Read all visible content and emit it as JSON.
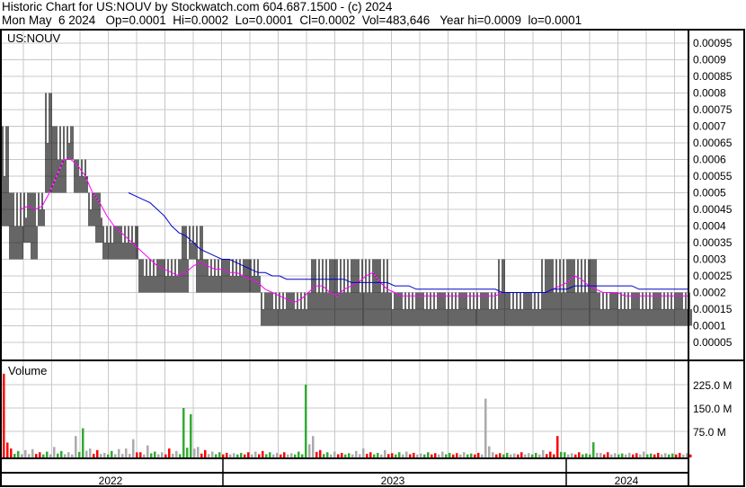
{
  "header": {
    "title": "Historic Chart for US:NOUV by Stockwatch.com 604.687.1500 - (c) 2024",
    "quote": "Mon May  6 2024   Op=0.0001  Hi=0.0002  Lo=0.0001  Cl=0.0002  Vol=483,646   Year hi=0.0009  lo=0.0001"
  },
  "chart_data": {
    "type": "bar",
    "symbol_label": "US:NOUV",
    "volume_label": "Volume",
    "price_ylim": [
      0,
      0.001
    ],
    "price_ticks": [
      "0.00095",
      "0.0009",
      "0.00085",
      "0.0008",
      "0.00075",
      "0.0007",
      "0.00065",
      "0.0006",
      "0.00055",
      "0.0005",
      "0.00045",
      "0.0004",
      "0.00035",
      "0.0003",
      "0.00025",
      "0.0002",
      "0.00015",
      "0.0001",
      "0.00005"
    ],
    "volume_ticks": [
      "225.0 M",
      "150.0 M",
      "75.0 M"
    ],
    "volume_tick_values": [
      225,
      150,
      75
    ],
    "x_years": [
      "2022",
      "2023",
      "2024"
    ],
    "grid": true,
    "colors": {
      "bar": "#000000",
      "ma_short": "#ff00ff",
      "ma_long": "#0000cc",
      "up": "#33aa33",
      "down": "#ff0000",
      "flat": "#aaaaaa",
      "grid": "#c8c8c8"
    },
    "high": [
      0.0007,
      0.0005,
      0.0005,
      0.0005,
      0.0005,
      0.0005,
      0.0008,
      0.0007,
      0.0007,
      0.0007,
      0.0006,
      0.0006,
      0.0005,
      0.0005,
      0.0004,
      0.0004,
      0.0004,
      0.0004,
      0.0004,
      0.0003,
      0.0003,
      0.0003,
      0.0003,
      0.0003,
      0.0003,
      0.0004,
      0.0004,
      0.0004,
      0.0003,
      0.0003,
      0.0003,
      0.0003,
      0.0003,
      0.0003,
      0.0003,
      0.0003,
      0.0002,
      0.0002,
      0.0002,
      0.0002,
      0.0002,
      0.0002,
      0.0002,
      0.0003,
      0.0003,
      0.0003,
      0.0003,
      0.0003,
      0.0003,
      0.0003,
      0.0003,
      0.0003,
      0.0003,
      0.0003,
      0.0002,
      0.0002,
      0.0002,
      0.0002,
      0.0002,
      0.0002,
      0.0002,
      0.0002,
      0.0002,
      0.0002,
      0.0002,
      0.0002,
      0.0002,
      0.0002,
      0.0002,
      0.0003,
      0.0002,
      0.0002,
      0.0002,
      0.0002,
      0.0002,
      0.0003,
      0.0003,
      0.0003,
      0.0003,
      0.0003,
      0.0003,
      0.0003,
      0.0003,
      0.0002,
      0.0002,
      0.0002,
      0.0002,
      0.0002,
      0.0002,
      0.0002,
      0.0002,
      0.0002,
      0.0002,
      0.0002,
      0.0002,
      0.0002
    ],
    "low": [
      0.0004,
      0.0003,
      0.0003,
      0.00035,
      0.0003,
      0.0004,
      0.0005,
      0.0005,
      0.0005,
      0.0006,
      0.0005,
      0.0005,
      0.0004,
      0.00035,
      0.0003,
      0.0003,
      0.0003,
      0.0003,
      0.0003,
      0.0002,
      0.0002,
      0.0002,
      0.0002,
      0.0002,
      0.0002,
      0.0002,
      0.0003,
      0.0002,
      0.0002,
      0.0002,
      0.0002,
      0.0002,
      0.0002,
      0.0002,
      0.0002,
      0.0002,
      0.0001,
      0.0001,
      0.0001,
      0.0001,
      0.0001,
      0.0001,
      0.0001,
      0.0001,
      0.0001,
      0.0001,
      0.0001,
      0.0001,
      0.0001,
      0.0001,
      0.0001,
      0.0001,
      0.0001,
      0.0001,
      0.0001,
      0.0001,
      0.0001,
      0.0001,
      0.0001,
      0.0001,
      0.0001,
      0.0001,
      0.0001,
      0.0001,
      0.0001,
      0.0001,
      0.0001,
      0.0001,
      0.0001,
      0.0001,
      0.0001,
      0.0001,
      0.0001,
      0.0001,
      0.0001,
      0.0001,
      0.0001,
      0.0001,
      0.0001,
      0.0001,
      0.0001,
      0.0001,
      0.0001,
      0.0001,
      0.0001,
      0.0001,
      0.0001,
      0.0001,
      0.0001,
      0.0001,
      0.0001,
      0.0001,
      0.0001,
      0.0001,
      0.0001,
      0.0001
    ],
    "ma_short": [
      null,
      null,
      0.00045,
      0.00046,
      0.00045,
      0.00046,
      0.0005,
      0.00055,
      0.0006,
      0.0006,
      0.00058,
      0.00055,
      0.0005,
      0.00047,
      0.00043,
      0.0004,
      0.00038,
      0.00036,
      0.00034,
      0.00032,
      0.0003,
      0.00028,
      0.00027,
      0.00026,
      0.00025,
      0.00026,
      0.00028,
      0.00029,
      0.00028,
      0.00027,
      0.00027,
      0.00026,
      0.00026,
      0.00025,
      0.00024,
      0.00023,
      0.00021,
      0.0002,
      0.00019,
      0.00018,
      0.00017,
      0.00018,
      0.0002,
      0.00022,
      0.00022,
      0.0002,
      0.00019,
      0.00021,
      0.00022,
      0.00023,
      0.00025,
      0.00026,
      0.00023,
      0.00021,
      0.0002,
      0.00019,
      0.00019,
      0.00019,
      0.00019,
      0.00019,
      0.00019,
      0.00019,
      0.00019,
      0.00019,
      0.00019,
      0.00019,
      0.00019,
      0.00019,
      0.00019,
      0.0002,
      0.0002,
      0.0002,
      0.0002,
      0.0002,
      0.0002,
      0.0002,
      0.00021,
      0.00022,
      0.00023,
      0.00025,
      0.00024,
      0.00022,
      0.00021,
      0.0002,
      0.0002,
      0.0002,
      0.00019,
      0.00019,
      0.00019,
      0.00019,
      0.00019,
      0.00019,
      0.00019,
      0.00019,
      0.00019,
      0.00019
    ],
    "ma_long": [
      null,
      null,
      null,
      null,
      null,
      null,
      null,
      null,
      null,
      null,
      null,
      null,
      null,
      null,
      null,
      null,
      null,
      0.0005,
      0.00049,
      0.00048,
      0.00047,
      0.00045,
      0.00043,
      0.0004,
      0.00038,
      0.00037,
      0.00035,
      0.00033,
      0.00032,
      0.00031,
      0.0003,
      0.0003,
      0.00029,
      0.00028,
      0.00027,
      0.00026,
      0.00026,
      0.00025,
      0.00025,
      0.00024,
      0.00024,
      0.00024,
      0.00024,
      0.00024,
      0.00024,
      0.00024,
      0.00024,
      0.00024,
      0.00023,
      0.00023,
      0.00023,
      0.00023,
      0.00023,
      0.00023,
      0.00022,
      0.00022,
      0.00022,
      0.00021,
      0.00021,
      0.00021,
      0.00021,
      0.00021,
      0.00021,
      0.00021,
      0.00021,
      0.00021,
      0.00021,
      0.00021,
      0.00021,
      0.0002,
      0.0002,
      0.0002,
      0.0002,
      0.0002,
      0.0002,
      0.0002,
      0.00021,
      0.00021,
      0.00021,
      0.00022,
      0.00022,
      0.00022,
      0.00022,
      0.00022,
      0.00022,
      0.00022,
      0.00022,
      0.00022,
      0.00021,
      0.00021,
      0.00021,
      0.00021,
      0.00021,
      0.00021,
      0.00021,
      0.00021
    ],
    "volume_m": [
      260,
      20,
      12,
      15,
      18,
      8,
      10,
      25,
      12,
      8,
      60,
      85,
      20,
      15,
      6,
      12,
      18,
      20,
      50,
      8,
      30,
      10,
      8,
      20,
      12,
      150,
      130,
      25,
      15,
      10,
      8,
      6,
      5,
      6,
      8,
      10,
      12,
      8,
      6,
      8,
      5,
      10,
      225,
      60,
      15,
      8,
      10,
      6,
      5,
      12,
      20,
      8,
      6,
      15,
      5,
      8,
      10,
      6,
      4,
      8,
      5,
      10,
      6,
      5,
      8,
      4,
      6,
      180,
      8,
      5,
      6,
      4,
      8,
      5,
      6,
      15,
      10,
      60,
      8,
      5,
      8,
      4,
      40,
      6,
      8,
      5,
      4,
      6,
      5,
      10,
      4,
      6,
      5,
      4,
      6,
      5
    ],
    "volume_dir": [
      "down",
      "down",
      "up",
      "flat",
      "flat",
      "down",
      "up",
      "flat",
      "up",
      "flat",
      "flat",
      "up",
      "flat",
      "down",
      "flat",
      "up",
      "flat",
      "flat",
      "flat",
      "down",
      "flat",
      "up",
      "flat",
      "down",
      "flat",
      "up",
      "up",
      "flat",
      "down",
      "flat",
      "up",
      "down",
      "flat",
      "up",
      "down",
      "flat",
      "down",
      "up",
      "flat",
      "down",
      "flat",
      "up",
      "up",
      "flat",
      "down",
      "up",
      "flat",
      "down",
      "up",
      "flat",
      "flat",
      "down",
      "up",
      "flat",
      "down",
      "up",
      "flat",
      "down",
      "flat",
      "up",
      "down",
      "flat",
      "up",
      "down",
      "flat",
      "up",
      "down",
      "flat",
      "flat",
      "down",
      "up",
      "flat",
      "down",
      "flat",
      "up",
      "flat",
      "down",
      "down",
      "up",
      "flat",
      "down",
      "up",
      "up",
      "flat",
      "down",
      "flat",
      "up",
      "flat",
      "down",
      "flat",
      "up",
      "down",
      "flat",
      "up",
      "down",
      "flat"
    ]
  }
}
